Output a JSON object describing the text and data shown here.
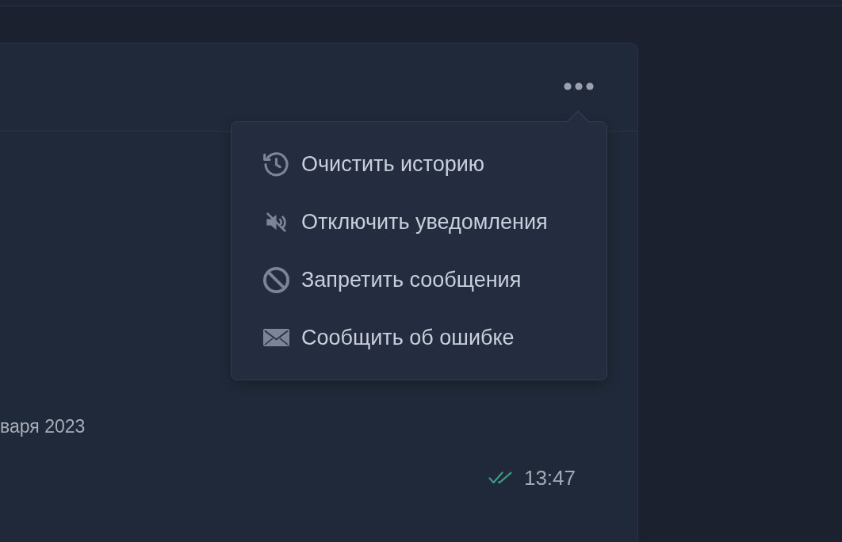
{
  "chat": {
    "date": "варя 2023",
    "time": "13:47",
    "read": true
  },
  "menu": {
    "items": [
      {
        "kind": "history",
        "label": "Очистить историю"
      },
      {
        "kind": "mute",
        "label": "Отключить уведомления"
      },
      {
        "kind": "block",
        "label": "Запретить сообщения"
      },
      {
        "kind": "report",
        "label": "Сообщить об ошибке"
      }
    ]
  }
}
